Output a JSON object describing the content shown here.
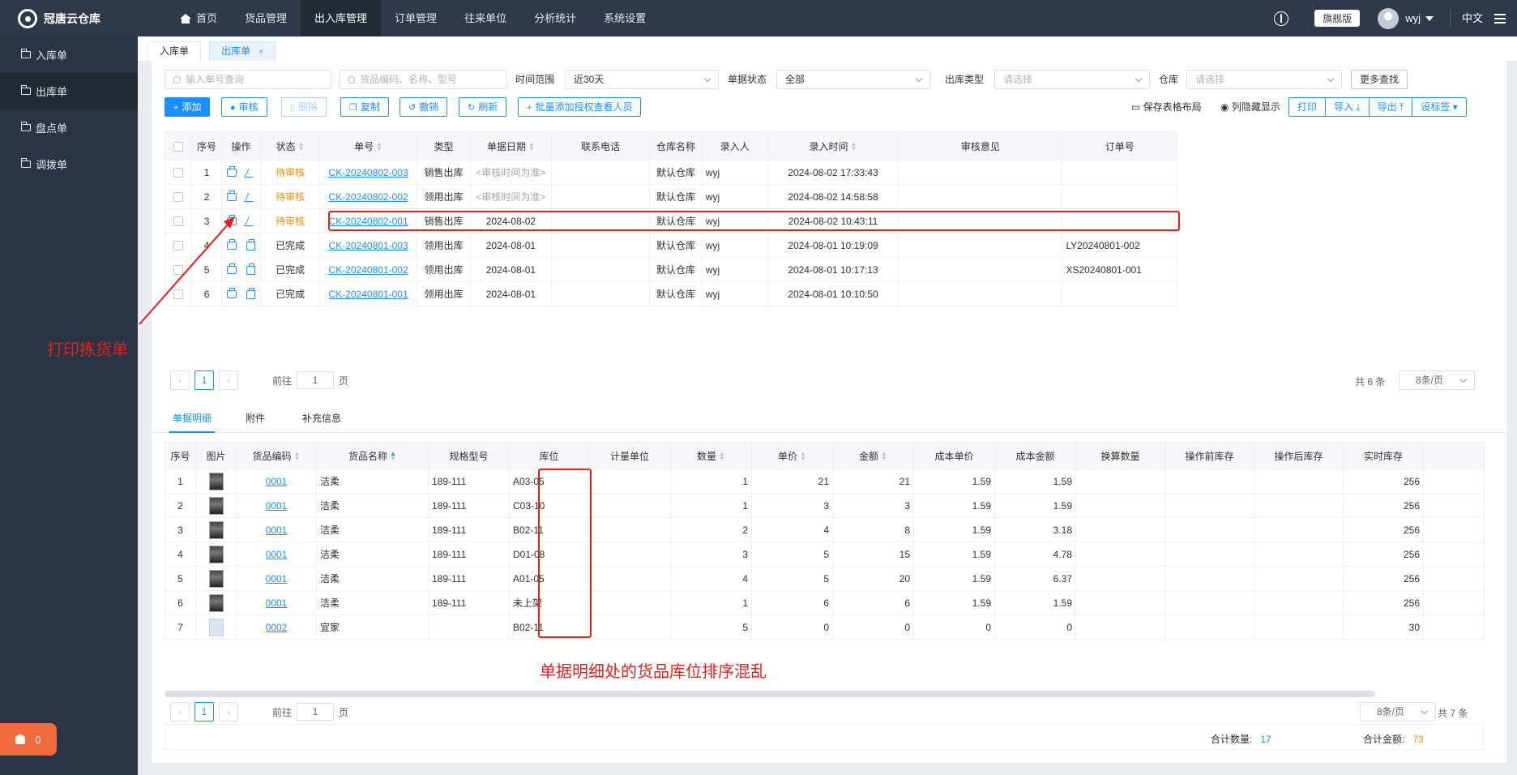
{
  "app": {
    "name": "冠唐云仓库"
  },
  "topnav": [
    {
      "label": "首页",
      "icon": "home-icon"
    },
    {
      "label": "货品管理"
    },
    {
      "label": "出入库管理",
      "active": true
    },
    {
      "label": "订单管理"
    },
    {
      "label": "往来单位"
    },
    {
      "label": "分析统计"
    },
    {
      "label": "系统设置"
    }
  ],
  "header": {
    "edition": "旗舰版",
    "user": "wyj",
    "lang": "中文"
  },
  "sidebar": [
    {
      "label": "入库单"
    },
    {
      "label": "出库单",
      "active": true
    },
    {
      "label": "盘点单"
    },
    {
      "label": "调拨单"
    }
  ],
  "alarm": {
    "count": "0"
  },
  "pagetabs": [
    {
      "label": "入库单"
    },
    {
      "label": "出库单",
      "active": true,
      "close": "×"
    }
  ],
  "filters": {
    "order_no_placeholder": "输入单号查询",
    "goods_placeholder": "货品编码、名称、型号",
    "time_label": "时间范围",
    "time_value": "近30天",
    "status_label": "单据状态",
    "status_value": "全部",
    "type_label": "出库类型",
    "type_placeholder": "请选择",
    "warehouse_label": "仓库",
    "warehouse_placeholder": "请选择",
    "more": "更多查找"
  },
  "toolbar": {
    "add": "添加",
    "audit": "审核",
    "delete": "删除",
    "copy": "复制",
    "revoke": "撤销",
    "refresh": "刷新",
    "batch": "批量添加授权查看人员",
    "save_layout": "保存表格布局",
    "column_toggle": "列隐藏显示",
    "print": "打印",
    "import": "导入",
    "export": "导出",
    "settings": "设标签"
  },
  "main_table": {
    "headers": [
      "序号",
      "操作",
      "状态",
      "单号",
      "类型",
      "单据日期",
      "联系电话",
      "仓库名称",
      "录入人",
      "录入时间",
      "审核意见",
      "订单号"
    ],
    "rows": [
      {
        "no": "1",
        "status": "待审核",
        "order": "CK-20240802-003",
        "type": "销售出库",
        "date": "<审核时间为准>",
        "phone": "",
        "warehouse": "默认仓库",
        "user": "wyj",
        "time": "2024-08-02 17:33:43",
        "opinion": "",
        "ref": ""
      },
      {
        "no": "2",
        "status": "待审核",
        "order": "CK-20240802-002",
        "type": "领用出库",
        "date": "<审核时间为准>",
        "phone": "",
        "warehouse": "默认仓库",
        "user": "wyj",
        "time": "2024-08-02 14:58:58",
        "opinion": "",
        "ref": ""
      },
      {
        "no": "3",
        "status": "待审核",
        "order": "CK-20240802-001",
        "type": "销售出库",
        "date": "2024-08-02",
        "phone": "",
        "warehouse": "默认仓库",
        "user": "wyj",
        "time": "2024-08-02 10:43:11",
        "opinion": "",
        "ref": ""
      },
      {
        "no": "4",
        "status": "已完成",
        "order": "CK-20240801-003",
        "type": "领用出库",
        "date": "2024-08-01",
        "phone": "",
        "warehouse": "默认仓库",
        "user": "wyj",
        "time": "2024-08-01 10:19:09",
        "opinion": "",
        "ref": "LY20240801-002"
      },
      {
        "no": "5",
        "status": "已完成",
        "order": "CK-20240801-002",
        "type": "领用出库",
        "date": "2024-08-01",
        "phone": "",
        "warehouse": "默认仓库",
        "user": "wyj",
        "time": "2024-08-01 10:17:13",
        "opinion": "",
        "ref": "XS20240801-001"
      },
      {
        "no": "6",
        "status": "已完成",
        "order": "CK-20240801-001",
        "type": "领用出库",
        "date": "2024-08-01",
        "phone": "",
        "warehouse": "默认仓库",
        "user": "wyj",
        "time": "2024-08-01 10:10:50",
        "opinion": "",
        "ref": ""
      }
    ]
  },
  "pager_main": {
    "page": "1",
    "goto": "前往",
    "goto_value": "1",
    "page_unit": "页",
    "total": "共 6 条",
    "size": "8条/页"
  },
  "subtabs": [
    "单据明细",
    "附件",
    "补充信息"
  ],
  "detail_table": {
    "headers": [
      "序号",
      "图片",
      "货品编码",
      "货品名称",
      "规格型号",
      "库位",
      "计量单位",
      "数量",
      "单价",
      "金额",
      "成本单价",
      "成本金额",
      "换算数量",
      "操作前库存",
      "操作后库存",
      "实时库存"
    ],
    "rows": [
      {
        "no": "1",
        "code": "0001",
        "name": "洁柔",
        "spec": "189-111",
        "loc": "A03-05",
        "unit": "",
        "qty": "1",
        "price": "21",
        "amount": "21",
        "cost": "1.59",
        "cost_amt": "1.59",
        "conv": "",
        "before": "",
        "after": "",
        "stock": "256",
        "img": true
      },
      {
        "no": "2",
        "code": "0001",
        "name": "洁柔",
        "spec": "189-111",
        "loc": "C03-10",
        "unit": "",
        "qty": "1",
        "price": "3",
        "amount": "3",
        "cost": "1.59",
        "cost_amt": "1.59",
        "conv": "",
        "before": "",
        "after": "",
        "stock": "256",
        "img": true
      },
      {
        "no": "3",
        "code": "0001",
        "name": "洁柔",
        "spec": "189-111",
        "loc": "B02-11",
        "unit": "",
        "qty": "2",
        "price": "4",
        "amount": "8",
        "cost": "1.59",
        "cost_amt": "3.18",
        "conv": "",
        "before": "",
        "after": "",
        "stock": "256",
        "img": true
      },
      {
        "no": "4",
        "code": "0001",
        "name": "洁柔",
        "spec": "189-111",
        "loc": "D01-08",
        "unit": "",
        "qty": "3",
        "price": "5",
        "amount": "15",
        "cost": "1.59",
        "cost_amt": "4.78",
        "conv": "",
        "before": "",
        "after": "",
        "stock": "256",
        "img": true
      },
      {
        "no": "5",
        "code": "0001",
        "name": "洁柔",
        "spec": "189-111",
        "loc": "A01-05",
        "unit": "",
        "qty": "4",
        "price": "5",
        "amount": "20",
        "cost": "1.59",
        "cost_amt": "6.37",
        "conv": "",
        "before": "",
        "after": "",
        "stock": "256",
        "img": true
      },
      {
        "no": "6",
        "code": "0001",
        "name": "洁柔",
        "spec": "189-111",
        "loc": "未上架",
        "unit": "",
        "qty": "1",
        "price": "6",
        "amount": "6",
        "cost": "1.59",
        "cost_amt": "1.59",
        "conv": "",
        "before": "",
        "after": "",
        "stock": "256",
        "img": true
      },
      {
        "no": "7",
        "code": "0002",
        "name": "宜家",
        "spec": "",
        "loc": "B02-11",
        "unit": "",
        "qty": "5",
        "price": "0",
        "amount": "0",
        "cost": "0",
        "cost_amt": "0",
        "conv": "",
        "before": "",
        "after": "",
        "stock": "30",
        "img": false
      }
    ]
  },
  "pager_detail": {
    "page": "1",
    "goto": "前往",
    "goto_value": "1",
    "page_unit": "页",
    "size": "8条/页",
    "total": "共 7 条"
  },
  "summary": {
    "qty_label": "合计数量:",
    "qty": "17",
    "amount_label": "合计金额:",
    "amount": "73"
  },
  "annotations": {
    "print_note": "打印拣货单",
    "location_note": "单据明细处的货品库位排序混乱"
  }
}
